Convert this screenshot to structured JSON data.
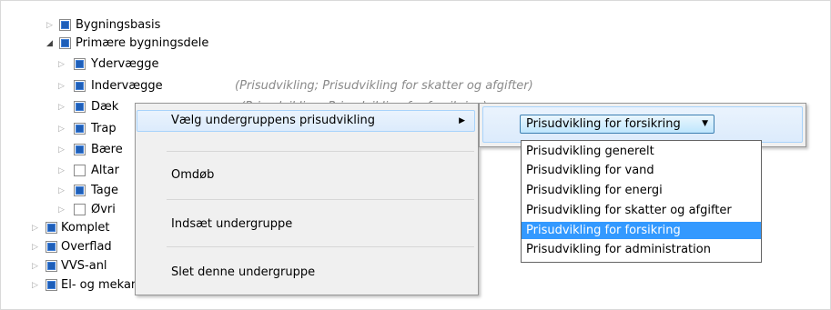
{
  "tree": {
    "rows": [
      {
        "label": "Bygningsbasis",
        "expanded": false
      },
      {
        "label": "Primære bygningsdele",
        "expanded": true
      },
      {
        "label": "Ydervægge"
      },
      {
        "label": "Indervægge",
        "hint": "(Prisudvikling; Prisudvikling for skatter og afgifter)"
      },
      {
        "label": "Dæk",
        "hint": "(Prisudvikling; Prisudvikling for forsikring)"
      },
      {
        "label": "Trap"
      },
      {
        "label": "Bære"
      },
      {
        "label": "Altar"
      },
      {
        "label": "Tage"
      },
      {
        "label": "Øvri"
      },
      {
        "label": "Komplet"
      },
      {
        "label": "Overflad"
      },
      {
        "label": "VVS-anl"
      },
      {
        "label": "El- og mekaniske anlæg"
      }
    ]
  },
  "context_menu": {
    "items": [
      {
        "label": "Vælg undergruppens prisudvikling"
      },
      {
        "label": "Omdøb"
      },
      {
        "label": "Indsæt undergruppe"
      },
      {
        "label": "Slet denne undergruppe"
      }
    ]
  },
  "submenu": {
    "combo_value": "Prisudvikling for forsikring",
    "options": [
      "Prisudvikling generelt",
      "Prisudvikling for vand",
      "Prisudvikling for energi",
      "Prisudvikling for skatter og afgifter",
      "Prisudvikling for forsikring",
      "Prisudvikling for administration"
    ],
    "selected_index": 4
  },
  "icons": {
    "expand": "triangle-right-icon",
    "collapse": "triangle-down-icon",
    "submenu": "triangle-right-icon",
    "dropdown": "triangle-down-icon"
  },
  "colors": {
    "checkbox_fill": "#1f5fb8",
    "selected_option_bg": "#3399ff",
    "menu_bg": "#f0f0f0",
    "hint_text": "#8a8a8a"
  }
}
